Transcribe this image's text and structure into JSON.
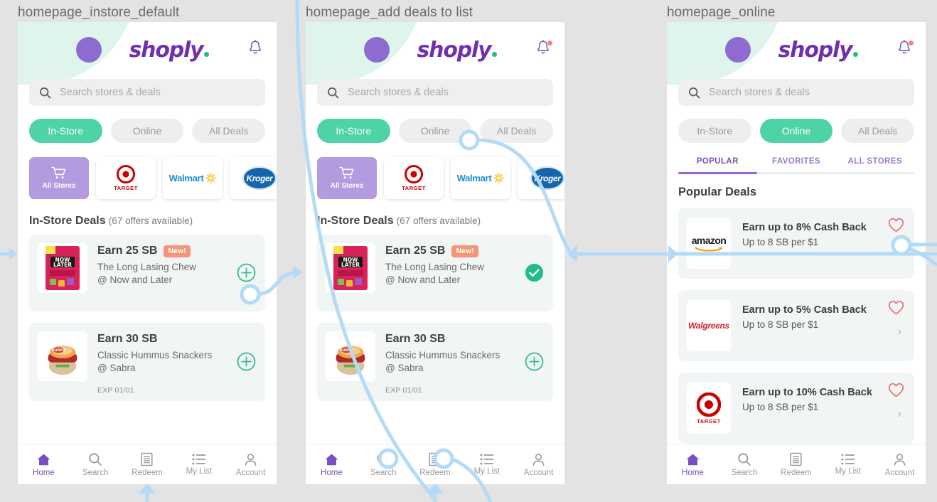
{
  "colors": {
    "background": "#e3e3e3",
    "accent_green": "#4ed3a4",
    "brand_purple": "#6f2fae",
    "nav_active_purple": "#7b4fc0",
    "avatar_purple": "#8d6bd0",
    "mint": "#dff5ec",
    "badge_orange": "#f79477",
    "heart_red": "#ef6b75",
    "connector_blue": "#aed8f7",
    "card_bg": "#f1f5f4"
  },
  "frames": [
    {
      "title": "homepage_instore_default"
    },
    {
      "title": "homepage_add deals to list"
    },
    {
      "title": "homepage_online"
    }
  ],
  "brand": {
    "word": "shoply",
    "dot": "."
  },
  "search": {
    "placeholder": "Search stores & deals",
    "icon": "search-icon"
  },
  "chips": [
    {
      "label": "In-Store",
      "active_in": [
        1,
        2
      ]
    },
    {
      "label": "Online",
      "active_in": [
        3
      ]
    },
    {
      "label": "All Deals",
      "active_in": []
    }
  ],
  "stores": [
    {
      "name": "All Stores",
      "icon": "shopping-cart-icon",
      "selected": true
    },
    {
      "name": "TARGET",
      "icon": "target-logo"
    },
    {
      "name": "Walmart",
      "icon": "walmart-logo"
    },
    {
      "name": "Kroger",
      "icon": "kroger-logo"
    }
  ],
  "instore_section": {
    "title": "In-Store Deals",
    "count_label": "(67 offers available)"
  },
  "instore_deals": [
    {
      "title": "Earn 25 SB",
      "badge": "New!",
      "line1": "The Long Lasing Chew",
      "line2": "@ Now and Later",
      "exp": "",
      "thumb": "now-and-later-candy",
      "action_default": "plus-circle-icon",
      "action_added": "check-circle-filled-icon"
    },
    {
      "title": "Earn 30 SB",
      "badge": "",
      "line1": "Classic Hummus Snackers",
      "line2": "@ Sabra",
      "exp": "EXP 01/01",
      "thumb": "sabra-hummus",
      "action_default": "plus-circle-icon",
      "action_added": "plus-circle-icon"
    }
  ],
  "online_tabs": [
    {
      "label": "POPULAR",
      "active": true
    },
    {
      "label": "FAVORITES",
      "active": false
    },
    {
      "label": "ALL STORES",
      "active": false
    }
  ],
  "online_section": {
    "title": "Popular Deals"
  },
  "online_deals": [
    {
      "title": "Earn up to 8% Cash Back",
      "sub": "Up to 8 SB per $1",
      "logo": "amazon-logo",
      "logo_text": "amazon",
      "heart": "heart-outline-icon",
      "chevron": "chevron-right-icon"
    },
    {
      "title": "Earn up to 5% Cash Back",
      "sub": "Up to 8 SB per $1",
      "logo": "walgreens-logo",
      "logo_text": "Walgreens",
      "heart": "heart-outline-icon",
      "chevron": "chevron-right-icon"
    },
    {
      "title": "Earn up to 10% Cash Back",
      "sub": "Up to 8 SB per $1",
      "logo": "target-logo",
      "logo_text": "TARGET",
      "heart": "heart-outline-icon",
      "chevron": "chevron-right-icon"
    }
  ],
  "tabbar": [
    {
      "label": "Home",
      "icon": "home-icon",
      "active": true
    },
    {
      "label": "Search",
      "icon": "search-icon",
      "active": false
    },
    {
      "label": "Redeem",
      "icon": "receipt-icon",
      "active": false
    },
    {
      "label": "My List",
      "icon": "list-icon",
      "active": false
    },
    {
      "label": "Account",
      "icon": "person-icon",
      "active": false
    }
  ],
  "notifications": {
    "panel1_badge": false,
    "panel2_badge": true,
    "panel3_badge": true
  }
}
